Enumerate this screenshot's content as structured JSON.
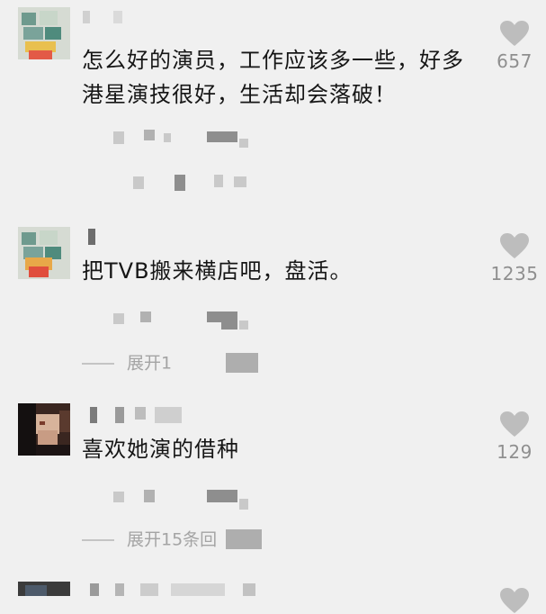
{
  "comments": [
    {
      "text": "怎么好的演员，工作应该多一些，好多港星演技很好，生活却会落破！",
      "likes": "657",
      "expand_label": ""
    },
    {
      "text": "把TVB搬来横店吧，盘活。",
      "likes": "1235",
      "expand_label": "展开1"
    },
    {
      "text": "喜欢她演的借种",
      "likes": "129",
      "expand_label": "展开15条回"
    }
  ],
  "icons": {
    "like": "heart-icon"
  },
  "colors": {
    "background": "#f0f0f0",
    "like": "#bdbdbd",
    "meta": "#a4a4a4"
  }
}
